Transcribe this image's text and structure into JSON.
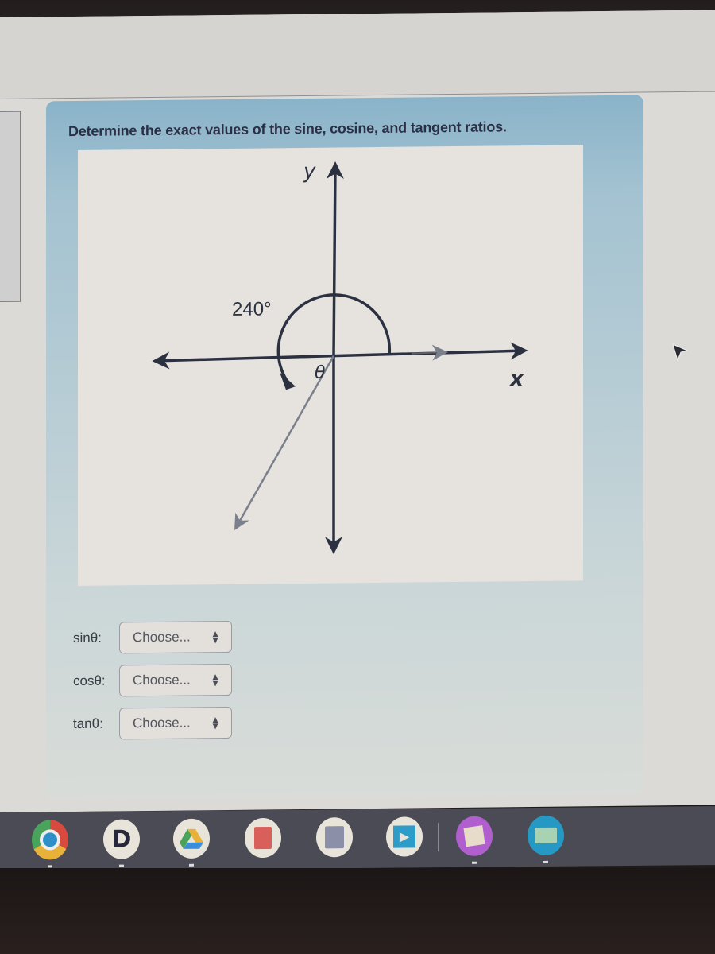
{
  "question": {
    "prompt": "Determine the exact values of the sine, cosine, and tangent ratios."
  },
  "figure": {
    "y_axis_label": "y",
    "x_axis_label": "x",
    "angle_label": "240°",
    "theta_label": "θ",
    "angle_degrees": 240
  },
  "answers": [
    {
      "label": "sinθ:",
      "selected": "Choose..."
    },
    {
      "label": "cosθ:",
      "selected": "Choose..."
    },
    {
      "label": "tanθ:",
      "selected": "Choose..."
    }
  ],
  "shelf": {
    "apps": [
      {
        "name": "Chrome",
        "icon": "chrome-icon"
      },
      {
        "name": "Docs app",
        "icon": "d-app-icon"
      },
      {
        "name": "Google Drive",
        "icon": "drive-icon"
      },
      {
        "name": "Red document app",
        "icon": "red-doc-icon"
      },
      {
        "name": "Gray document app",
        "icon": "gray-doc-icon"
      },
      {
        "name": "Blue play app",
        "icon": "play-app-icon"
      },
      {
        "name": "Purple sticky app",
        "icon": "purple-app-icon"
      },
      {
        "name": "Files",
        "icon": "files-icon"
      }
    ]
  },
  "colors": {
    "card_blue": "#8ab3c9",
    "text_dark": "#2a2f45",
    "shelf": "#4b4b55"
  }
}
